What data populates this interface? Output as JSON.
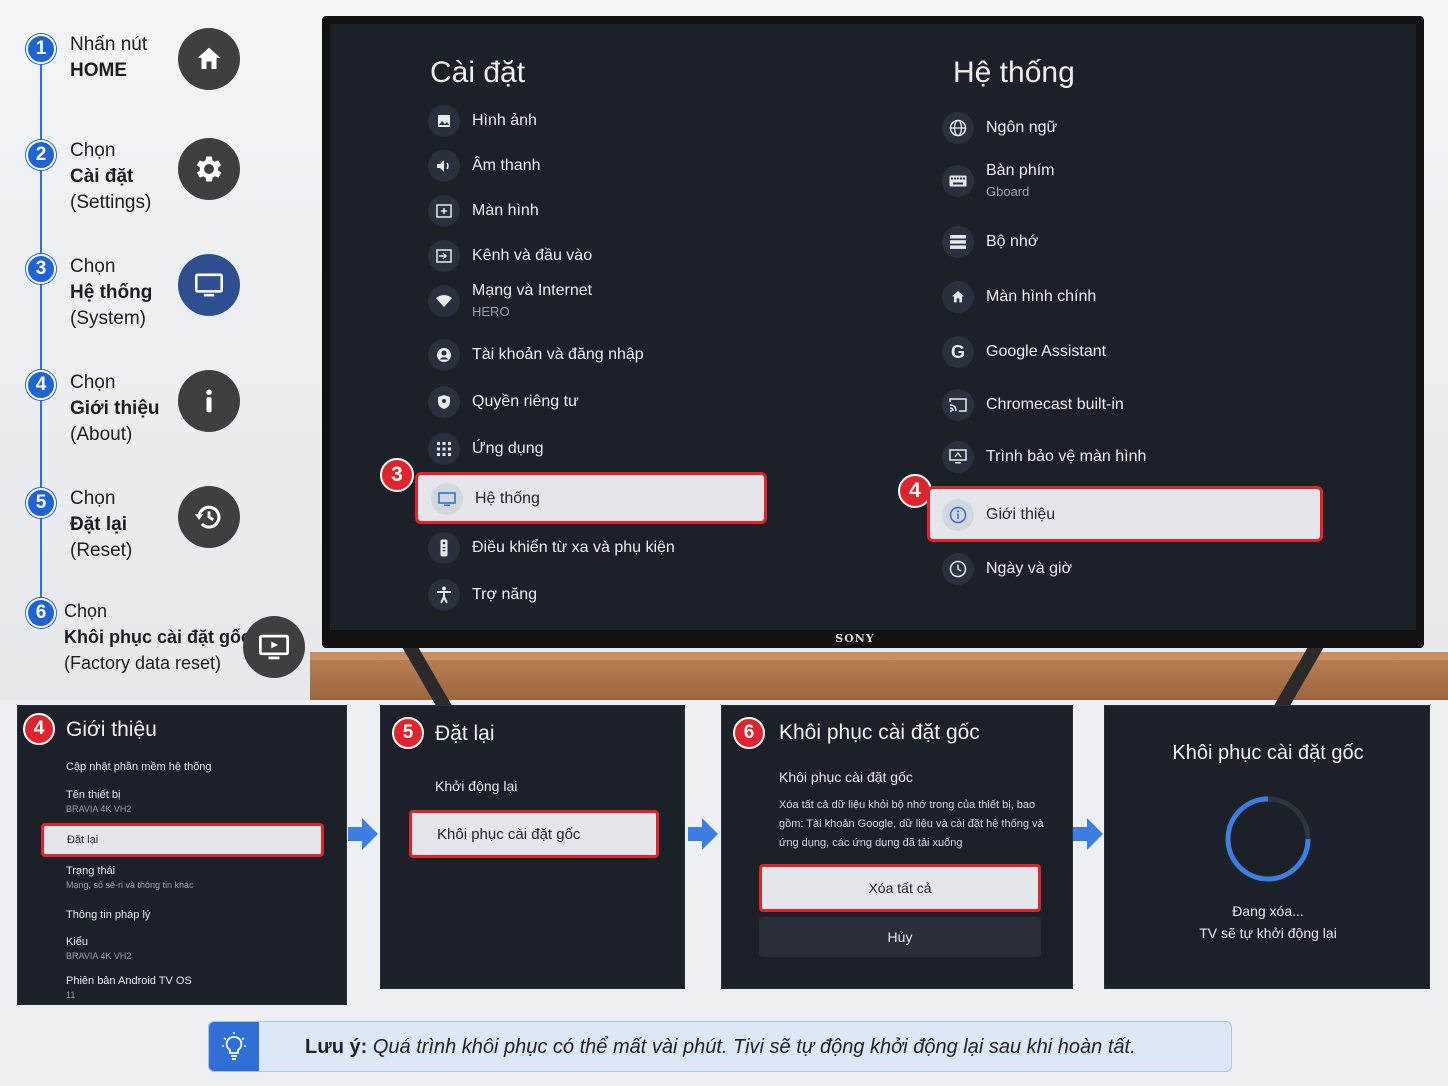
{
  "steps": [
    {
      "num": "1",
      "line1": "Nhấn nút",
      "line2": "HOME",
      "line3": "",
      "icon": "home-icon"
    },
    {
      "num": "2",
      "line1": "Chọn",
      "line2": "Cài đặt",
      "line3": "(Settings)",
      "icon": "gear-icon"
    },
    {
      "num": "3",
      "line1": "Chọn",
      "line2": "Hệ thống",
      "line3": "(System)",
      "icon": "monitor-icon"
    },
    {
      "num": "4",
      "line1": "Chọn",
      "line2": "Giới thiệu",
      "line3": "(About)",
      "icon": "info-icon"
    },
    {
      "num": "5",
      "line1": "Chọn",
      "line2": "Đặt lại",
      "line3": "(Reset)",
      "icon": "reset-icon"
    },
    {
      "num": "6",
      "line1": "Chọn",
      "line2": "Khôi phục cài đặt gốc",
      "line3": "(Factory data reset)",
      "icon": "factory-reset-icon"
    }
  ],
  "tv": {
    "brand": "SONY",
    "settings": {
      "title": "Cài đặt",
      "items": [
        {
          "label": "Hình ảnh",
          "sub": "",
          "icon": "picture-icon"
        },
        {
          "label": "Âm thanh",
          "sub": "",
          "icon": "sound-icon"
        },
        {
          "label": "Màn hình",
          "sub": "",
          "icon": "screen-icon"
        },
        {
          "label": "Kênh và đầu vào",
          "sub": "",
          "icon": "input-icon"
        },
        {
          "label": "Mạng và Internet",
          "sub": "HERO",
          "icon": "wifi-icon"
        },
        {
          "label": "Tài khoản và đăng nhập",
          "sub": "",
          "icon": "account-icon"
        },
        {
          "label": "Quyền riêng tư",
          "sub": "",
          "icon": "privacy-icon"
        },
        {
          "label": "Ứng dụng",
          "sub": "",
          "icon": "apps-icon"
        },
        {
          "label": "Hệ thống",
          "sub": "",
          "icon": "monitor-icon"
        },
        {
          "label": "Điều khiển từ xa và phụ kiện",
          "sub": "",
          "icon": "remote-icon"
        },
        {
          "label": "Trợ năng",
          "sub": "",
          "icon": "accessibility-icon"
        }
      ],
      "badge": "3"
    },
    "system": {
      "title": "Hệ thống",
      "items": [
        {
          "label": "Ngôn ngữ",
          "sub": "",
          "icon": "globe-icon"
        },
        {
          "label": "Bàn phím",
          "sub": "Gboard",
          "icon": "keyboard-icon"
        },
        {
          "label": "Bộ nhớ",
          "sub": "",
          "icon": "storage-icon"
        },
        {
          "label": "Màn hình chính",
          "sub": "",
          "icon": "home-icon"
        },
        {
          "label": "Google Assistant",
          "sub": "",
          "icon": "google-icon"
        },
        {
          "label": "Chromecast built-in",
          "sub": "",
          "icon": "cast-icon"
        },
        {
          "label": "Trình bảo vệ màn hình",
          "sub": "",
          "icon": "screensaver-icon"
        },
        {
          "label": "Giới thiệu",
          "sub": "",
          "icon": "info-icon"
        },
        {
          "label": "Ngày và giờ",
          "sub": "",
          "icon": "clock-icon"
        }
      ],
      "badge": "4"
    }
  },
  "panels": {
    "about": {
      "badge": "4",
      "title": "Giới thiệu",
      "items": [
        {
          "label": "Cập nhật phần mềm hệ thống",
          "sub": ""
        },
        {
          "label": "Tên thiết bị",
          "sub": "BRAVIA 4K VH2"
        },
        {
          "label": "Đặt lại",
          "sub": ""
        },
        {
          "label": "Trạng thái",
          "sub": "Mạng, số sê-ri và thông tin khác"
        },
        {
          "label": "Thông tin pháp lý",
          "sub": ""
        },
        {
          "label": "Kiểu",
          "sub": "BRAVIA 4K VH2"
        },
        {
          "label": "Phiên bản Android TV OS",
          "sub": "11"
        }
      ]
    },
    "reset": {
      "badge": "5",
      "title": "Đặt lại",
      "restart": "Khởi động lại",
      "factory": "Khôi phục cài đặt gốc"
    },
    "factory": {
      "badge": "6",
      "title": "Khôi phục cài đặt gốc",
      "subtitle": "Khôi phục cài đặt gốc",
      "description": "Xóa tất cả dữ liệu khỏi bộ nhớ trong của thiết bị, bao gồm: Tài khoản Google, dữ liệu và cài đặt hệ thống và ứng dụng, các ứng dụng đã tải xuống",
      "erase": "Xóa tất cả",
      "cancel": "Hủy"
    },
    "progress": {
      "title": "Khôi phục cài đặt gốc",
      "status": "Đang xóa...",
      "note": "TV sẽ tự khởi động lại"
    }
  },
  "note": {
    "label": "Lưu ý:",
    "text": "Quá trình khôi phục có thể mất vài phút. Tivi sẽ tự động khởi động lại sau khi hoàn tất."
  },
  "colors": {
    "accent": "#1f63d6",
    "highlight": "#e0242d",
    "screen": "#1c2029"
  }
}
